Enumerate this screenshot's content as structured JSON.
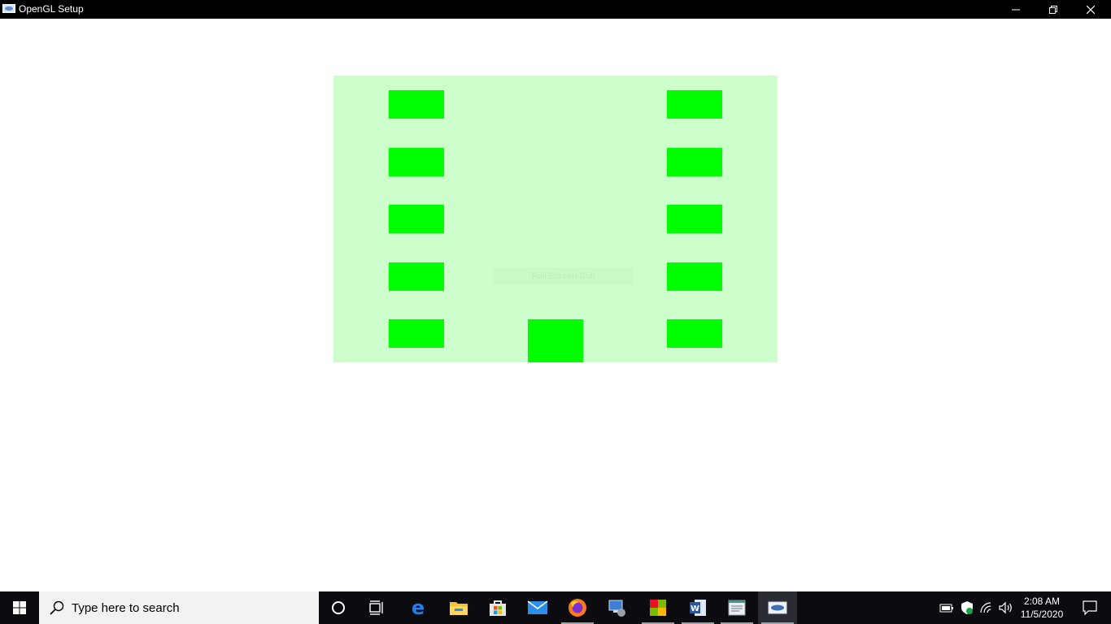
{
  "window": {
    "title": "OpenGL Setup",
    "minimize_icon": "minimize-icon",
    "restore_icon": "restore-icon",
    "close_icon": "close-icon"
  },
  "canvas": {
    "background_color": "#ccffcc",
    "block_color": "#00ff00",
    "overlay_text": "Full Screen Sub"
  },
  "taskbar": {
    "search_placeholder": "Type here to search",
    "pinned": [
      "cortana-icon",
      "task-view-icon",
      "edge-icon",
      "file-explorer-icon",
      "store-icon",
      "mail-icon",
      "firefox-icon",
      "remote-desktop-icon",
      "app-icon",
      "word-icon",
      "notepad-icon",
      "opengl-app-icon"
    ],
    "clock": {
      "time": "2:08 AM",
      "date": "11/5/2020"
    }
  }
}
